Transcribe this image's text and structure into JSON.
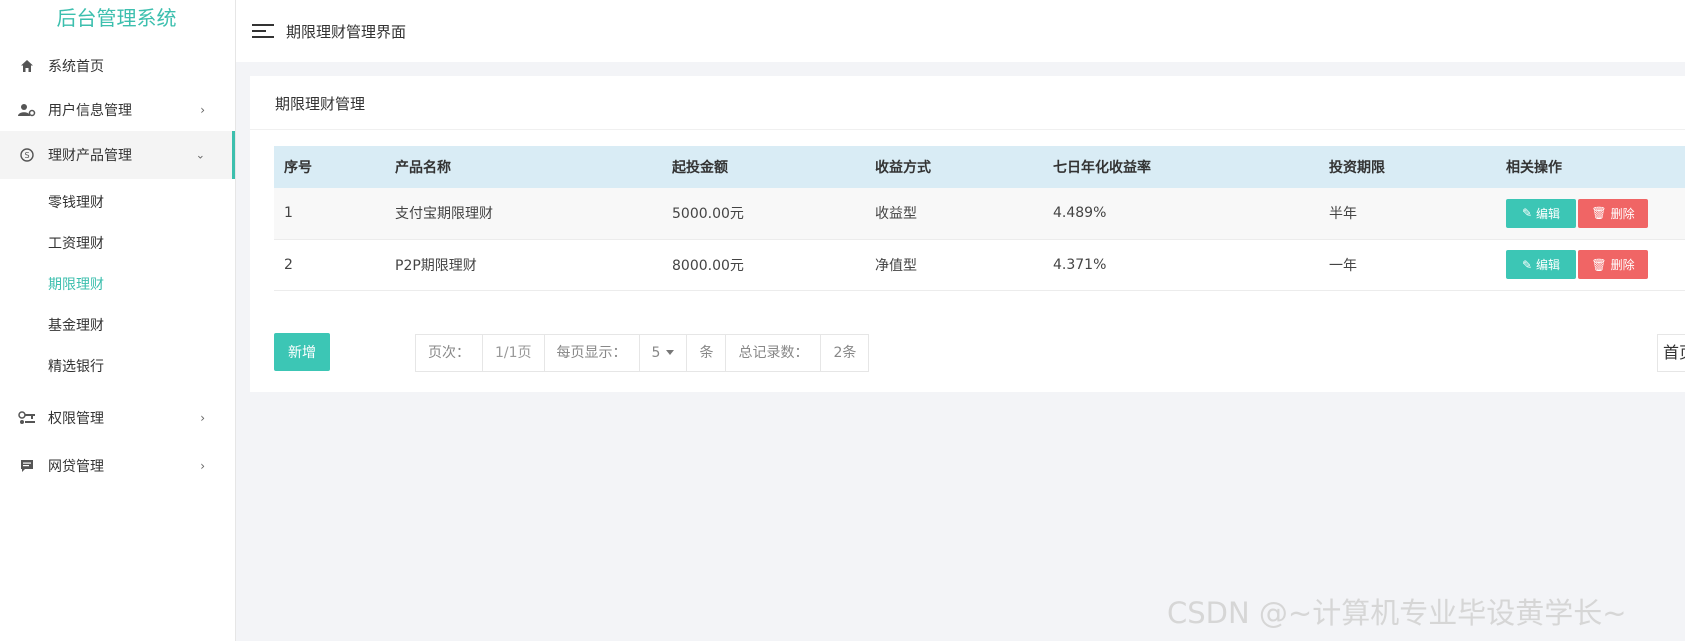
{
  "app": {
    "brand": "后台管理系统"
  },
  "sidebar": {
    "items": [
      {
        "label": "系统首页",
        "icon": "home-icon"
      },
      {
        "label": "用户信息管理",
        "icon": "user-settings-icon",
        "arrow": "›"
      },
      {
        "label": "理财产品管理",
        "icon": "skype-circle-icon",
        "arrow": "⌄",
        "children": [
          {
            "label": "零钱理财"
          },
          {
            "label": "工资理财"
          },
          {
            "label": "期限理财",
            "active": true
          },
          {
            "label": "基金理财"
          },
          {
            "label": "精选银行"
          }
        ]
      },
      {
        "label": "权限管理",
        "icon": "key-icon",
        "arrow": "›"
      },
      {
        "label": "网贷管理",
        "icon": "message-icon",
        "arrow": "›"
      }
    ]
  },
  "header": {
    "title": "期限理财管理界面"
  },
  "panel": {
    "title": "期限理财管理"
  },
  "table": {
    "headers": [
      "序号",
      "产品名称",
      "起投金额",
      "收益方式",
      "七日年化收益率",
      "投资期限",
      "相关操作"
    ],
    "rows": [
      {
        "id": "1",
        "name": "支付宝期限理财",
        "amount": "5000.00元",
        "type": "收益型",
        "rate": "4.489%",
        "term": "半年"
      },
      {
        "id": "2",
        "name": "P2P期限理财",
        "amount": "8000.00元",
        "type": "净值型",
        "rate": "4.371%",
        "term": "一年"
      }
    ],
    "edit_label": "编辑",
    "delete_label": "删除"
  },
  "actions": {
    "new_label": "新增"
  },
  "pager": {
    "page_label": "页次：",
    "page_value": "1/1页",
    "per_page_label": "每页显示：",
    "per_page_value": "5",
    "per_page_unit": "条",
    "total_label": "总记录数：",
    "total_value": "2条",
    "first_label": "首页"
  },
  "watermark": "CSDN @~计算机专业毕设黄学长~",
  "colors": {
    "accent": "#3cbfae",
    "danger": "#f06565",
    "table_header_bg": "#d9ecf5"
  }
}
